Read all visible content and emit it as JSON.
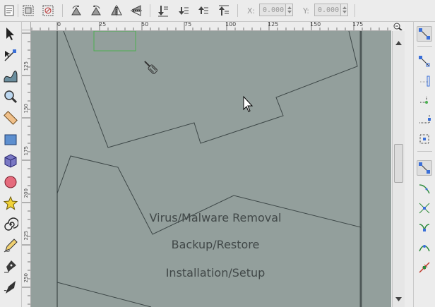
{
  "toolbar": {
    "x_label": "X:",
    "x_value": "0.000",
    "y_label": "Y:",
    "y_value": "0.000",
    "icons": [
      "select-all-icon",
      "select-all-layers-icon",
      "deselect-icon",
      "rotate-ccw-icon",
      "rotate-cw-icon",
      "flip-horizontal-icon",
      "flip-vertical-icon",
      "lower-to-bottom-icon",
      "lower-icon",
      "raise-icon",
      "raise-to-top-icon"
    ]
  },
  "toolbox": {
    "tools": [
      "selector-tool",
      "node-tool",
      "tweak-tool",
      "zoom-tool",
      "measure-tool",
      "rectangle-tool",
      "3d-box-tool",
      "ellipse-tool",
      "star-tool",
      "spiral-tool",
      "pencil-tool",
      "pen-tool",
      "calligraphy-tool"
    ]
  },
  "rulers": {
    "horizontal_labels": [
      "0",
      "25",
      "50",
      "75",
      "100",
      "125",
      "150",
      "175"
    ],
    "vertical_labels": [
      "125",
      "150",
      "175",
      "200",
      "225",
      "250"
    ]
  },
  "canvas": {
    "background": "#939f9c",
    "stroke": "#3d4747",
    "selection_color": "#4caf50",
    "texts": {
      "line1": "Virus/Malware Removal",
      "line2": "Backup/Restore",
      "line3": "Installation/Setup"
    }
  },
  "snap": {
    "items": [
      "snap-toggle",
      "snap-bbox",
      "snap-bbox-edges",
      "snap-bbox-corners",
      "snap-bbox-midpoints",
      "snap-bbox-centers",
      "snap-nodes",
      "snap-paths",
      "snap-path-intersections",
      "snap-cusp-nodes",
      "snap-smooth-nodes",
      "snap-line-midpoints"
    ]
  }
}
